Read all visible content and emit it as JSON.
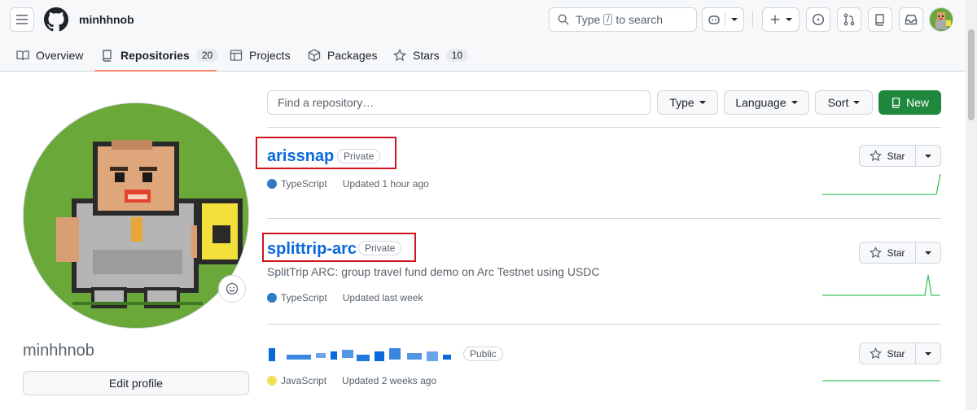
{
  "header": {
    "username": "minhhnob",
    "search": {
      "prefix": "Type",
      "key": "/",
      "suffix": "to search"
    }
  },
  "tabs": [
    {
      "label": "Overview",
      "count": ""
    },
    {
      "label": "Repositories",
      "count": "20"
    },
    {
      "label": "Projects",
      "count": ""
    },
    {
      "label": "Packages",
      "count": ""
    },
    {
      "label": "Stars",
      "count": "10"
    }
  ],
  "profile": {
    "username": "minhhnob",
    "edit_label": "Edit profile"
  },
  "repo_filter": {
    "placeholder": "Find a repository…",
    "type_label": "Type",
    "language_label": "Language",
    "sort_label": "Sort",
    "new_label": "New"
  },
  "repos": [
    {
      "name": "arissnap",
      "visibility": "Private",
      "description": "",
      "language": "TypeScript",
      "language_color": "#3178c6",
      "updated": "Updated 1 hour ago",
      "star_label": "Star"
    },
    {
      "name": "splittrip-arc",
      "visibility": "Private",
      "description": "SplitTrip ARC: group travel fund demo on Arc Testnet using USDC",
      "language": "TypeScript",
      "language_color": "#3178c6",
      "updated": "Updated last week",
      "star_label": "Star"
    },
    {
      "name": "",
      "visibility": "Public",
      "description": "",
      "language": "JavaScript",
      "language_color": "#f1e05a",
      "updated": "Updated 2 weeks ago",
      "star_label": "Star"
    }
  ],
  "colors": {
    "accent": "#0969da",
    "new_button": "#1f883d",
    "tab_underline": "#fd8c73",
    "annotation_box": "#d0141e"
  }
}
